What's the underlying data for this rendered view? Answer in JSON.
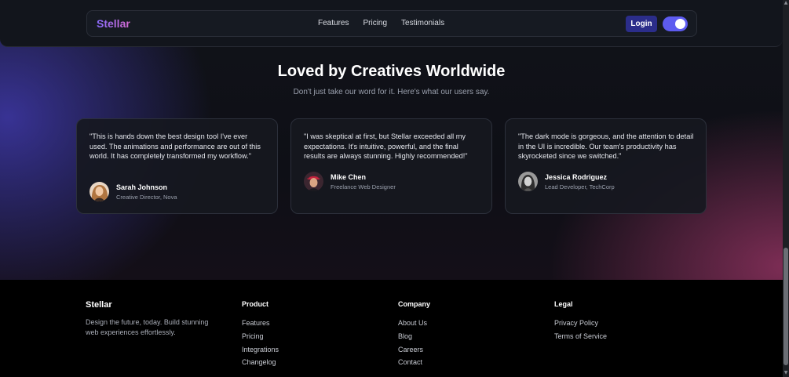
{
  "navbar": {
    "brand": "Stellar",
    "links": [
      "Features",
      "Pricing",
      "Testimonials"
    ],
    "login_label": "Login",
    "theme_toggle_on": true
  },
  "testimonials": {
    "title": "Loved by Creatives Worldwide",
    "subtitle": "Don't just take our word for it. Here's what our users say.",
    "cards": [
      {
        "quote": "\"This is hands down the best design tool I've ever used. The animations and performance are out of this world. It has completely transformed my workflow.\"",
        "name": "Sarah Johnson",
        "role": "Creative Director, Nova"
      },
      {
        "quote": "\"I was skeptical at first, but Stellar exceeded all my expectations. It's intuitive, powerful, and the final results are always stunning. Highly recommended!\"",
        "name": "Mike Chen",
        "role": "Freelance Web Designer"
      },
      {
        "quote": "\"The dark mode is gorgeous, and the attention to detail in the UI is incredible. Our team's productivity has skyrocketed since we switched.\"",
        "name": "Jessica Rodriguez",
        "role": "Lead Developer, TechCorp"
      }
    ]
  },
  "footer": {
    "brand": "Stellar",
    "description": "Design the future, today. Build stunning web experiences effortlessly.",
    "columns": [
      {
        "title": "Product",
        "links": [
          "Features",
          "Pricing",
          "Integrations",
          "Changelog"
        ]
      },
      {
        "title": "Company",
        "links": [
          "About Us",
          "Blog",
          "Careers",
          "Contact"
        ]
      },
      {
        "title": "Legal",
        "links": [
          "Privacy Policy",
          "Terms of Service"
        ]
      }
    ]
  },
  "colors": {
    "accent": "#5d5bf0",
    "login_bg": "#2b2d8a",
    "brand_gradient_start": "#8a6cff",
    "brand_gradient_end": "#d66bd1"
  }
}
